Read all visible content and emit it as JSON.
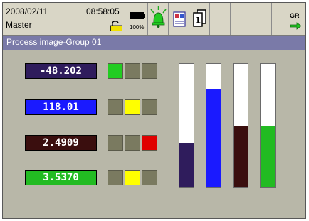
{
  "status_bar": {
    "date": "2008/02/11",
    "time": "08:58:05",
    "user": "Master",
    "battery_label": "100%",
    "gr_label": "GR"
  },
  "page_title": "Process image-Group 01",
  "channels": [
    {
      "value": "-48.202",
      "color": "#2f1c5c",
      "indicators": [
        "#22cc22",
        "#7a7a60",
        "#7a7a60"
      ],
      "bar_fraction": 0.36
    },
    {
      "value": "118.01",
      "color": "#1a1aff",
      "indicators": [
        "#7a7a60",
        "#ffff00",
        "#7a7a60"
      ],
      "bar_fraction": 0.8
    },
    {
      "value": "2.4909",
      "color": "#3a0e0e",
      "indicators": [
        "#7a7a60",
        "#7a7a60",
        "#e00000"
      ],
      "bar_fraction": 0.49
    },
    {
      "value": "3.5370",
      "color": "#22bb22",
      "indicators": [
        "#7a7a60",
        "#ffff00",
        "#7a7a60"
      ],
      "bar_fraction": 0.49
    }
  ],
  "colors": {
    "screen_bg": "#b8b7a8",
    "title_bar": "#7a7aa8",
    "indicator_off": "#7a7a60"
  },
  "icons": [
    "battery-icon",
    "alarm-bell-icon",
    "memory-card-icon",
    "copy-pages-icon",
    "gr-switch-icon",
    "lock-icon"
  ]
}
